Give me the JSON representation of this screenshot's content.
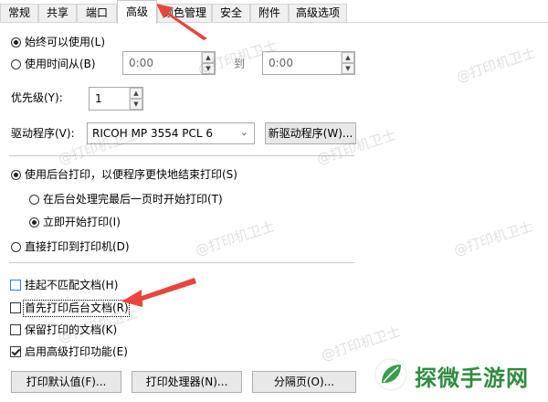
{
  "tabs": [
    {
      "label": "常规",
      "active": false
    },
    {
      "label": "共享",
      "active": false
    },
    {
      "label": "端口",
      "active": false
    },
    {
      "label": "高级",
      "active": true
    },
    {
      "label": "颜色管理",
      "active": false
    },
    {
      "label": "安全",
      "active": false
    },
    {
      "label": "附件",
      "active": false
    },
    {
      "label": "高级选项",
      "active": false
    }
  ],
  "availability": {
    "always_label": "始终可以使用(L)",
    "from_label": "使用时间从(B)",
    "from_time": "0:00",
    "to_label": "到",
    "to_time": "0:00"
  },
  "priority": {
    "label": "优先级(Y):",
    "value": "1"
  },
  "driver": {
    "label": "驱动程序(V):",
    "value": "RICOH MP 3554 PCL 6",
    "new_driver_button": "新驱动程序(W)..."
  },
  "spool": {
    "spool_label": "使用后台打印，以便程序更快地结束打印(S)",
    "after_last_page_label": "在后台处理完最后一页时开始打印(T)",
    "immediately_label": "立即开始打印(I)",
    "direct_label": "直接打印到打印机(D)"
  },
  "options": {
    "hold_mismatched_label": "挂起不匹配文档(H)",
    "print_spooled_first_label": "首先打印后台文档(R)",
    "keep_printed_label": "保留打印的文档(K)",
    "advanced_features_label": "启用高级打印功能(E)"
  },
  "buttons": {
    "defaults": "打印默认值(F)...",
    "processor": "打印处理器(N)...",
    "separator": "分隔页(O)..."
  },
  "watermark": "@打印机卫士",
  "logo_text": "探微手游网",
  "colors": {
    "arrow": "#e8453c",
    "logo_green": "#2f8c3e"
  }
}
